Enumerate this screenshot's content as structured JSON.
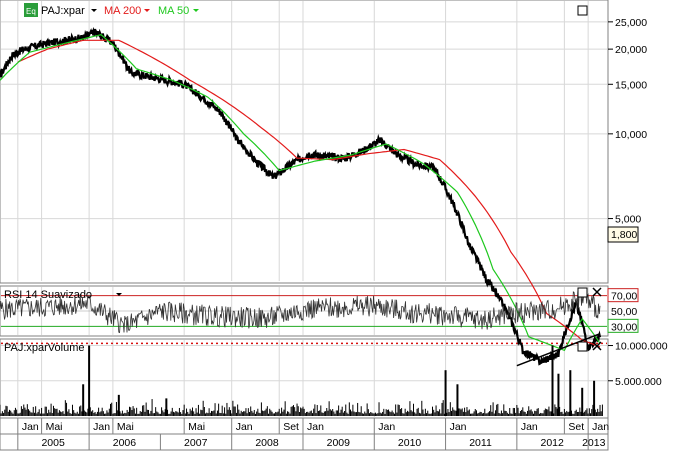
{
  "colors": {
    "price": "#000000",
    "ma200": "#e31b1b",
    "ma50": "#1ec81e",
    "rsi": "#333333",
    "rsi_upper": "#cc2222",
    "rsi_lower": "#22aa22",
    "volume": "#000000",
    "level": "#d81010",
    "trend": "#000000",
    "panel_border": "#808080",
    "grid": "#d8d8d8"
  },
  "header": {
    "symbol": "PAJ:xpar",
    "ma200_label": "MA 200",
    "ma50_label": "MA 50",
    "eq_icon_label": "Eq"
  },
  "chart_data": [
    {
      "type": "line",
      "panel": "price",
      "scale": "log",
      "ylim": [
        3000,
        28000
      ],
      "y_ticks": [
        "25,000",
        "20,000",
        "15,000",
        "10,000",
        "5,000"
      ],
      "y_tick_values": [
        25000,
        20000,
        15000,
        10000,
        5000
      ],
      "level_line": {
        "value": 1800,
        "label": "1,800"
      },
      "series": [
        {
          "name": "PAJ:xpar",
          "values": [
            {
              "x": "2004-10",
              "y": 16000
            },
            {
              "x": "2004-12",
              "y": 19000
            },
            {
              "x": "2005-02",
              "y": 20000
            },
            {
              "x": "2005-04",
              "y": 20500
            },
            {
              "x": "2005-06",
              "y": 21000
            },
            {
              "x": "2005-09",
              "y": 21500
            },
            {
              "x": "2005-12",
              "y": 22000
            },
            {
              "x": "2006-02",
              "y": 23000
            },
            {
              "x": "2006-05",
              "y": 21000
            },
            {
              "x": "2006-08",
              "y": 16500
            },
            {
              "x": "2006-11",
              "y": 16000
            },
            {
              "x": "2007-02",
              "y": 15500
            },
            {
              "x": "2007-05",
              "y": 15000
            },
            {
              "x": "2007-08",
              "y": 13500
            },
            {
              "x": "2007-11",
              "y": 12000
            },
            {
              "x": "2008-02",
              "y": 9500
            },
            {
              "x": "2008-05",
              "y": 8000
            },
            {
              "x": "2008-08",
              "y": 7000
            },
            {
              "x": "2008-11",
              "y": 7800
            },
            {
              "x": "2009-02",
              "y": 8500
            },
            {
              "x": "2009-05",
              "y": 8300
            },
            {
              "x": "2009-08",
              "y": 8200
            },
            {
              "x": "2009-11",
              "y": 8700
            },
            {
              "x": "2010-02",
              "y": 9500
            },
            {
              "x": "2010-05",
              "y": 8400
            },
            {
              "x": "2010-08",
              "y": 7800
            },
            {
              "x": "2010-11",
              "y": 7600
            },
            {
              "x": "2011-02",
              "y": 5800
            },
            {
              "x": "2011-05",
              "y": 4000
            },
            {
              "x": "2011-08",
              "y": 3000
            },
            {
              "x": "2011-11",
              "y": 2400
            },
            {
              "x": "2012-02",
              "y": 1700
            },
            {
              "x": "2012-05",
              "y": 1550
            },
            {
              "x": "2012-08",
              "y": 1650
            },
            {
              "x": "2012-11",
              "y": 2500
            },
            {
              "x": "2013-01",
              "y": 1750
            },
            {
              "x": "2013-03",
              "y": 1900
            }
          ]
        },
        {
          "name": "MA 200",
          "values": [
            {
              "x": "2005-01",
              "y": 18000
            },
            {
              "x": "2005-06",
              "y": 20000
            },
            {
              "x": "2005-12",
              "y": 21500
            },
            {
              "x": "2006-06",
              "y": 21500
            },
            {
              "x": "2006-12",
              "y": 18500
            },
            {
              "x": "2007-06",
              "y": 15500
            },
            {
              "x": "2007-12",
              "y": 13000
            },
            {
              "x": "2008-06",
              "y": 10500
            },
            {
              "x": "2008-12",
              "y": 8200
            },
            {
              "x": "2009-06",
              "y": 8100
            },
            {
              "x": "2009-12",
              "y": 8500
            },
            {
              "x": "2010-06",
              "y": 8800
            },
            {
              "x": "2010-12",
              "y": 8100
            },
            {
              "x": "2011-06",
              "y": 6000
            },
            {
              "x": "2011-12",
              "y": 3800
            },
            {
              "x": "2012-06",
              "y": 2300
            },
            {
              "x": "2012-12",
              "y": 1850
            },
            {
              "x": "2013-03",
              "y": 1750
            }
          ]
        },
        {
          "name": "MA 50",
          "values": [
            {
              "x": "2004-10",
              "y": 15500
            },
            {
              "x": "2005-03",
              "y": 19500
            },
            {
              "x": "2005-09",
              "y": 21000
            },
            {
              "x": "2006-03",
              "y": 22500
            },
            {
              "x": "2006-09",
              "y": 17000
            },
            {
              "x": "2007-03",
              "y": 15500
            },
            {
              "x": "2007-09",
              "y": 13500
            },
            {
              "x": "2008-03",
              "y": 10000
            },
            {
              "x": "2008-09",
              "y": 7400
            },
            {
              "x": "2009-03",
              "y": 8000
            },
            {
              "x": "2009-09",
              "y": 8400
            },
            {
              "x": "2010-03",
              "y": 9200
            },
            {
              "x": "2010-09",
              "y": 7900
            },
            {
              "x": "2011-03",
              "y": 6200
            },
            {
              "x": "2011-09",
              "y": 3300
            },
            {
              "x": "2012-03",
              "y": 1900
            },
            {
              "x": "2012-09",
              "y": 1700
            },
            {
              "x": "2012-12",
              "y": 2200
            },
            {
              "x": "2013-03",
              "y": 1800
            }
          ]
        }
      ]
    },
    {
      "type": "line",
      "panel": "rsi",
      "title": "RSI 14 Suavizado",
      "ylim": [
        20,
        80
      ],
      "y_ticks": [
        "70,00",
        "50,00",
        "30,00"
      ],
      "y_tick_values": [
        70,
        50,
        30
      ],
      "series": [
        {
          "name": "RSI 14",
          "values": [
            {
              "x": "2004-10",
              "y": 52
            },
            {
              "x": "2005-06",
              "y": 55
            },
            {
              "x": "2006-01",
              "y": 60
            },
            {
              "x": "2006-07",
              "y": 30
            },
            {
              "x": "2007-01",
              "y": 50
            },
            {
              "x": "2007-07",
              "y": 45
            },
            {
              "x": "2008-01",
              "y": 42
            },
            {
              "x": "2008-07",
              "y": 40
            },
            {
              "x": "2009-01",
              "y": 52
            },
            {
              "x": "2009-07",
              "y": 55
            },
            {
              "x": "2010-01",
              "y": 57
            },
            {
              "x": "2010-07",
              "y": 48
            },
            {
              "x": "2011-01",
              "y": 45
            },
            {
              "x": "2011-07",
              "y": 38
            },
            {
              "x": "2012-01",
              "y": 48
            },
            {
              "x": "2012-07",
              "y": 52
            },
            {
              "x": "2012-12",
              "y": 68
            },
            {
              "x": "2013-03",
              "y": 50
            }
          ]
        }
      ]
    },
    {
      "type": "bar",
      "panel": "volume",
      "title": "PAJ:xparVolume",
      "ylim": [
        0,
        10500000
      ],
      "y_ticks": [
        "10.000.000",
        "5.000.000"
      ],
      "y_tick_values": [
        10000000,
        5000000
      ],
      "bars": [
        {
          "x": "2006-01",
          "y": 10000000
        },
        {
          "x": "2005-12",
          "y": 4500000
        },
        {
          "x": "2006-06",
          "y": 3000000
        },
        {
          "x": "2007-02",
          "y": 2500000
        },
        {
          "x": "2011-01",
          "y": 6500000
        },
        {
          "x": "2011-03",
          "y": 4500000
        },
        {
          "x": "2012-07",
          "y": 10000000
        },
        {
          "x": "2012-08",
          "y": 6000000
        },
        {
          "x": "2012-10",
          "y": 6500000
        },
        {
          "x": "2012-12",
          "y": 4000000
        },
        {
          "x": "2013-02",
          "y": 5000000
        }
      ]
    }
  ],
  "x_axis": {
    "month_labels": [
      {
        "x": "2005-01",
        "label": "Jan"
      },
      {
        "x": "2005-05",
        "label": "Mai"
      },
      {
        "x": "2006-01",
        "label": "Jan"
      },
      {
        "x": "2006-05",
        "label": "Mai"
      },
      {
        "x": "2007-05",
        "label": "Mai"
      },
      {
        "x": "2008-01",
        "label": "Jan"
      },
      {
        "x": "2008-09",
        "label": "Set"
      },
      {
        "x": "2009-01",
        "label": "Jan"
      },
      {
        "x": "2010-01",
        "label": "Jan"
      },
      {
        "x": "2011-01",
        "label": "Jan"
      },
      {
        "x": "2012-01",
        "label": "Jan"
      },
      {
        "x": "2012-09",
        "label": "Set"
      },
      {
        "x": "2013-01",
        "label": "Jan"
      }
    ],
    "year_labels": [
      {
        "x": "2005-07",
        "label": "2005"
      },
      {
        "x": "2006-07",
        "label": "2006"
      },
      {
        "x": "2007-07",
        "label": "2007"
      },
      {
        "x": "2008-07",
        "label": "2008"
      },
      {
        "x": "2009-07",
        "label": "2009"
      },
      {
        "x": "2010-07",
        "label": "2010"
      },
      {
        "x": "2011-07",
        "label": "2011"
      },
      {
        "x": "2012-07",
        "label": "2012"
      },
      {
        "x": "2013-02",
        "label": "2013"
      }
    ]
  }
}
